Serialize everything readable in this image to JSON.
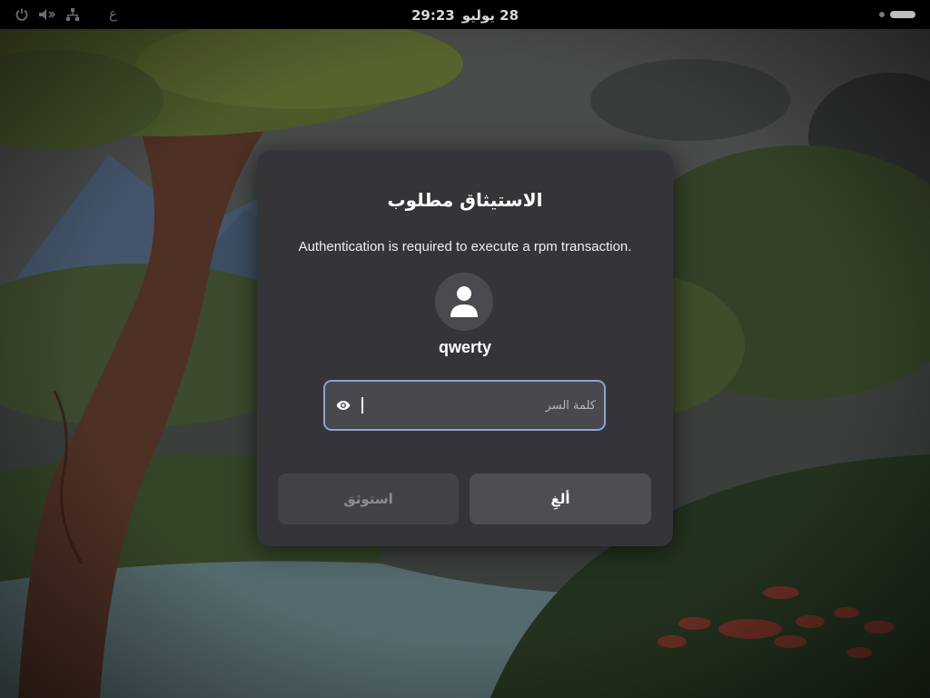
{
  "topbar": {
    "clock_date": "28 يوليو",
    "clock_time": "29:23",
    "input_method": "ع",
    "icons": [
      "power-icon",
      "volume-icon",
      "network-icon"
    ]
  },
  "dialog": {
    "title": "الاستيثاق مطلوب",
    "message": "Authentication is required to execute a rpm transaction.",
    "username": "qwerty",
    "password_placeholder": "كلمة السر",
    "password_value": "",
    "authenticate_label": "استوثق",
    "cancel_label": "ألغِ"
  },
  "colors": {
    "dialog_bg": "#353539",
    "field_focus_border": "#8ba4cf",
    "topbar_bg": "#000000"
  }
}
